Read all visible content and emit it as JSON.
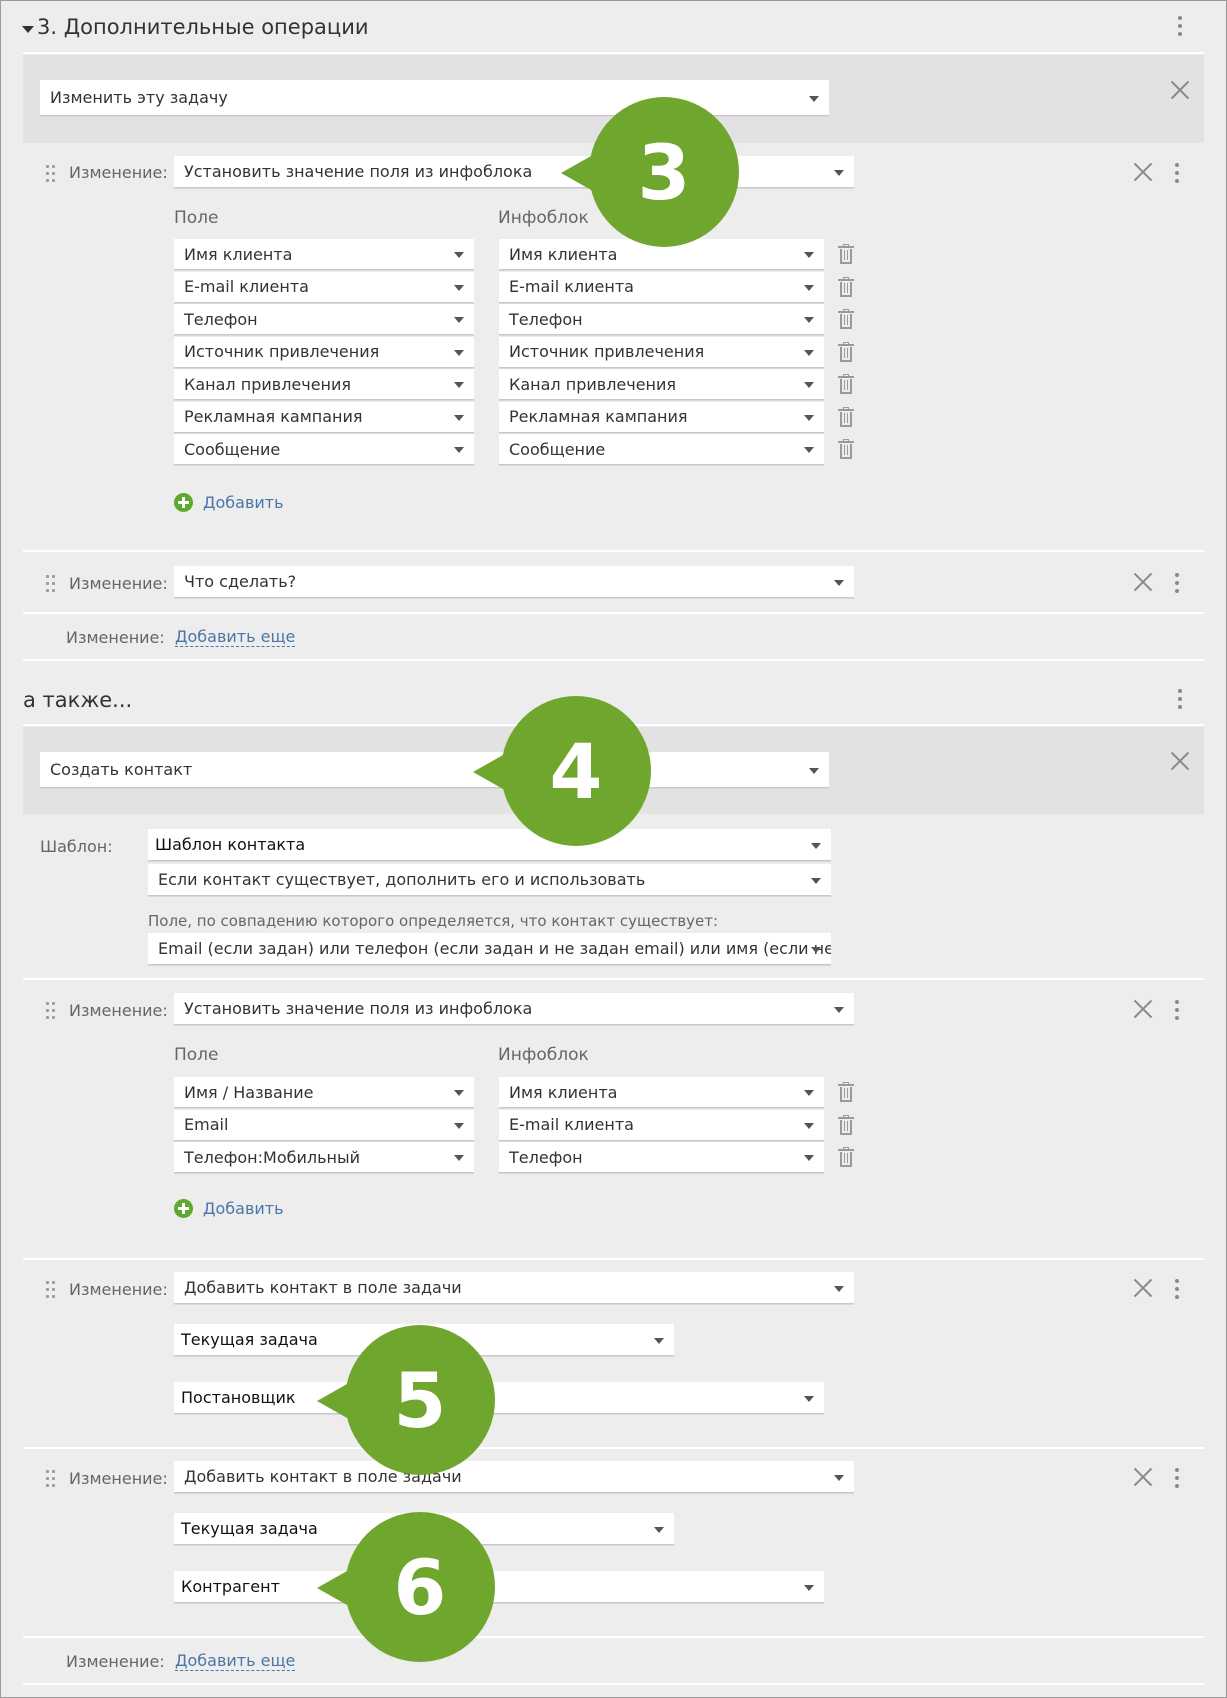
{
  "section3": {
    "title": "3. Дополнительные операции",
    "action_select": "Изменить эту задачу",
    "change1": {
      "label": "Изменение:",
      "select": "Установить значение поля из инфоблока",
      "col_field": "Поле",
      "col_iblock": "Инфоблок",
      "rows": [
        {
          "field": "Имя клиента",
          "iblock": "Имя клиента"
        },
        {
          "field": "E-mail клиента",
          "iblock": "E-mail клиента"
        },
        {
          "field": "Телефон",
          "iblock": "Телефон"
        },
        {
          "field": "Источник привлечения",
          "iblock": "Источник привлечения"
        },
        {
          "field": "Канал привлечения",
          "iblock": "Канал привлечения"
        },
        {
          "field": "Рекламная кампания",
          "iblock": "Рекламная кампания"
        },
        {
          "field": "Сообщение",
          "iblock": "Сообщение"
        }
      ],
      "add_label": "Добавить"
    },
    "change2": {
      "label": "Изменение:",
      "select": "Что сделать?"
    },
    "add_more": {
      "label": "Изменение:",
      "link": "Добавить еще"
    }
  },
  "section_also": {
    "title": "а также...",
    "action_select": "Создать контакт",
    "template_label": "Шаблон:",
    "template_select": "Шаблон контакта",
    "exists_select": "Если контакт существует, дополнить его и использовать",
    "match_hint": "Поле, по совпадению которого определяется, что контакт существует:",
    "match_select": "Email (если задан) или телефон (если задан и не задан email) или имя (если не задан",
    "change1": {
      "label": "Изменение:",
      "select": "Установить значение поля из инфоблока",
      "col_field": "Поле",
      "col_iblock": "Инфоблок",
      "rows": [
        {
          "field": "Имя / Название",
          "iblock": "Имя клиента"
        },
        {
          "field": "Email",
          "iblock": "E-mail клиента"
        },
        {
          "field": "Телефон:Мобильный",
          "iblock": "Телефон"
        }
      ],
      "add_label": "Добавить"
    },
    "change2": {
      "label": "Изменение:",
      "select": "Добавить контакт в поле задачи",
      "task": "Текущая задача",
      "field": "Постановщик"
    },
    "change3": {
      "label": "Изменение:",
      "select": "Добавить контакт в поле задачи",
      "task": "Текущая задача",
      "field": "Контрагент"
    },
    "add_more": {
      "label": "Изменение:",
      "link": "Добавить еще"
    }
  },
  "badges": [
    "3",
    "4",
    "5",
    "6"
  ],
  "colors": {
    "badge": "#6fa62d",
    "link": "#4a76a8",
    "add_icon": "#5fa82e",
    "panel": "#ededed",
    "band": "#e2e2e2"
  }
}
